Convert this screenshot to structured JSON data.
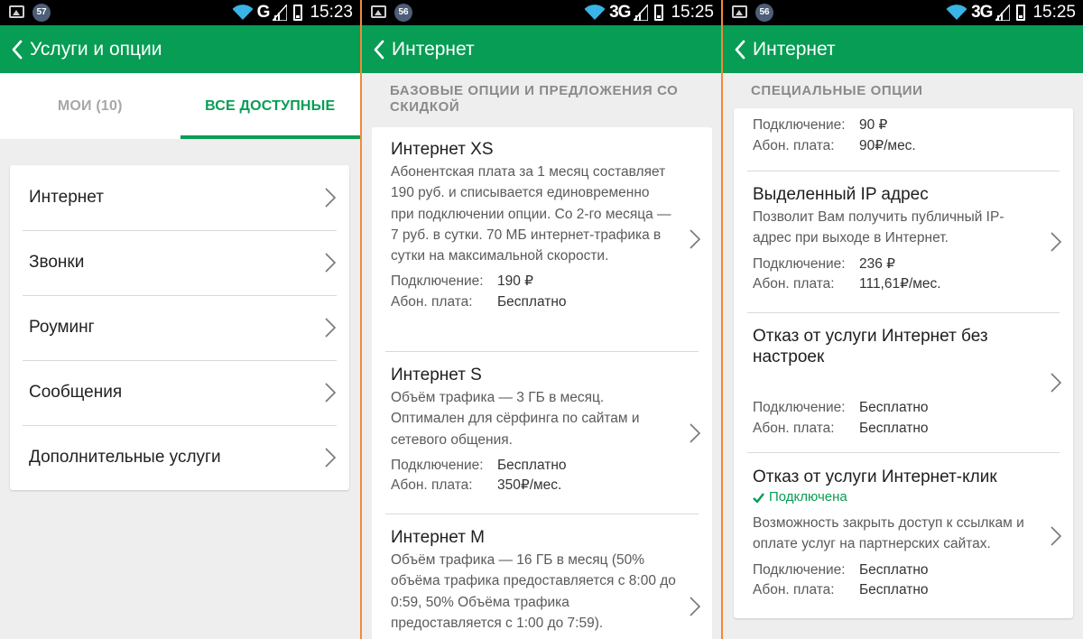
{
  "screens": [
    {
      "status": {
        "badge": "57",
        "network": "G",
        "time": "15:23"
      },
      "title": "Услуги и опции",
      "tabs": [
        {
          "label": "МОИ (10)"
        },
        {
          "label": "ВСЕ ДОСТУПНЫЕ"
        }
      ],
      "menu": [
        {
          "label": "Интернет"
        },
        {
          "label": "Звонки"
        },
        {
          "label": "Роуминг"
        },
        {
          "label": "Сообщения"
        },
        {
          "label": "Дополнительные услуги"
        }
      ]
    },
    {
      "status": {
        "badge": "56",
        "network": "3G",
        "time": "15:25"
      },
      "title": "Интернет",
      "section": "БАЗОВЫЕ ОПЦИИ И ПРЕДЛОЖЕНИЯ СО СКИДКОЙ",
      "options": [
        {
          "title": "Интернет XS",
          "desc": "Абонентская плата за 1 месяц составляет 190 руб. и списывается единовременно при подключении опции. Со 2-го месяца — 7 руб. в сутки. 70 МБ интернет-трафика в сутки на максимальной скорости.",
          "connect_label": "Подключение:",
          "connect_value": "190 ₽",
          "fee_label": "Абон. плата:",
          "fee_value": "Бесплатно"
        },
        {
          "title": "Интернет S",
          "desc": "Объём трафика — 3 ГБ в месяц. Оптимален для сёрфинга по сайтам и сетевого общения.",
          "connect_label": "Подключение:",
          "connect_value": "Бесплатно",
          "fee_label": "Абон. плата:",
          "fee_value": "350₽/мес."
        },
        {
          "title": "Интернет M",
          "desc": "Объём трафика — 16 ГБ в месяц (50% объёма трафика предоставляется с 8:00 до 0:59, 50% Объёма трафика предоставляется с 1:00 до 7:59)."
        }
      ]
    },
    {
      "status": {
        "badge": "56",
        "network": "3G",
        "time": "15:25"
      },
      "title": "Интернет",
      "section": "СПЕЦИАЛЬНЫЕ ОПЦИИ",
      "options": [
        {
          "connect_label": "Подключение:",
          "connect_value": "90 ₽",
          "fee_label": "Абон. плата:",
          "fee_value": "90₽/мес."
        },
        {
          "title": "Выделенный IP адрес",
          "desc": "Позволит Вам получить публичный IP-адрес при выходе в Интернет.",
          "connect_label": "Подключение:",
          "connect_value": "236 ₽",
          "fee_label": "Абон. плата:",
          "fee_value": "111,61₽/мес."
        },
        {
          "title": "Отказ от услуги Интернет без настроек",
          "connect_label": "Подключение:",
          "connect_value": "Бесплатно",
          "fee_label": "Абон. плата:",
          "fee_value": "Бесплатно"
        },
        {
          "title": "Отказ от услуги Интернет-клик",
          "status": "Подключена",
          "desc": "Возможность закрыть доступ к ссылкам и оплате услуг на партнерских сайтах.",
          "connect_label": "Подключение:",
          "connect_value": "Бесплатно",
          "fee_label": "Абон. плата:",
          "fee_value": "Бесплатно"
        }
      ]
    }
  ],
  "icons": {
    "back": "chevron-left-icon",
    "chevron": "chevron-right-icon",
    "wifi": "wifi-icon",
    "signal": "signal-icon",
    "battery": "battery-icon",
    "gallery": "gallery-icon",
    "check": "check-icon"
  },
  "colors": {
    "accent": "#079d54",
    "statusbar": "#000000",
    "background": "#eeeeee",
    "divider": "#f08a3a"
  }
}
